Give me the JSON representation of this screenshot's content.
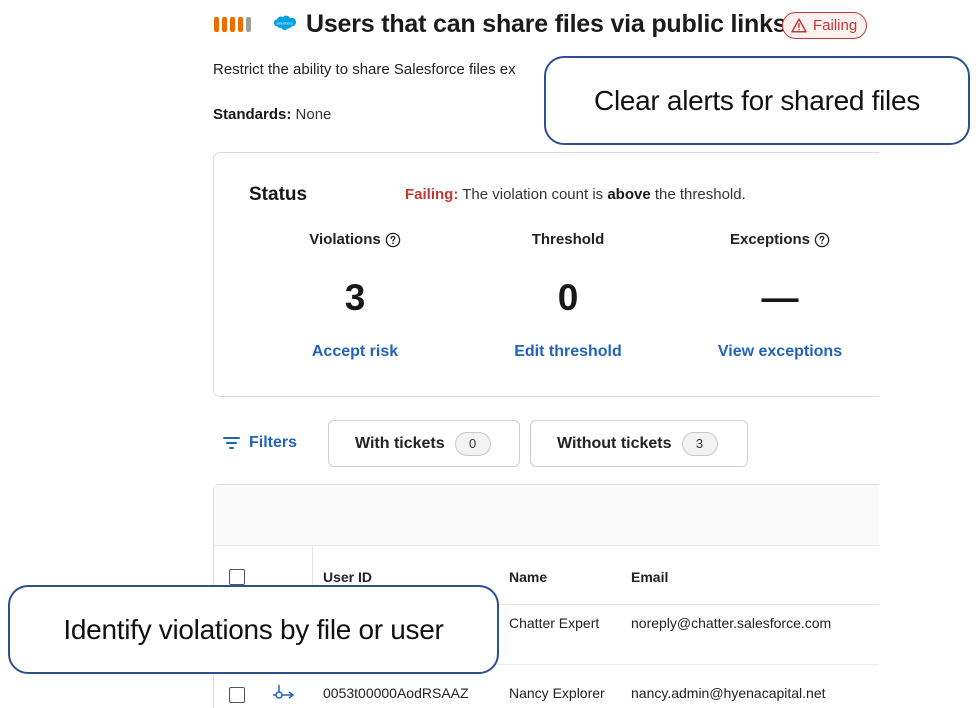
{
  "header": {
    "title": "Users that can share files via public links",
    "status_badge": "Failing",
    "description": "Restrict the ability to share Salesforce files ex",
    "standards_label": "Standards:",
    "standards_value": "None"
  },
  "status": {
    "title": "Status",
    "message_prefix": "Failing:",
    "message_text": "The violation count is",
    "message_bold": "above",
    "message_suffix": "the threshold.",
    "metrics": [
      {
        "label": "Violations",
        "value": "3",
        "action": "Accept risk",
        "has_help": true
      },
      {
        "label": "Threshold",
        "value": "0",
        "action": "Edit threshold",
        "has_help": false
      },
      {
        "label": "Exceptions",
        "value": "—",
        "action": "View exceptions",
        "has_help": true
      }
    ]
  },
  "filters": {
    "label": "Filters",
    "chips": [
      {
        "label": "With tickets",
        "count": "0"
      },
      {
        "label": "Without tickets",
        "count": "3"
      }
    ]
  },
  "table": {
    "columns": [
      "User ID",
      "Name",
      "Email"
    ],
    "rows": [
      {
        "user_id": "",
        "name": "Chatter Expert",
        "email": "noreply@chatter.salesforce.com"
      },
      {
        "user_id": "0053t00000AodRSAAZ",
        "name": "Nancy Explorer",
        "email": "nancy.admin@hyenacapital.net"
      }
    ]
  },
  "callouts": {
    "top": "Clear alerts for shared files",
    "bottom": "Identify violations by file or user"
  },
  "colors": {
    "severity": "#ef6c00",
    "failing": "#c23934",
    "link": "#1f64b8",
    "callout_border": "#2f4f8f",
    "salesforce": "#00a1e0"
  },
  "icons": {
    "severity": "severity-bars-icon",
    "logo": "salesforce-cloud-icon",
    "badge": "warning-triangle-icon",
    "help": "help-circle-icon",
    "filter": "filter-lines-icon",
    "row_link": "link-chain-icon"
  }
}
